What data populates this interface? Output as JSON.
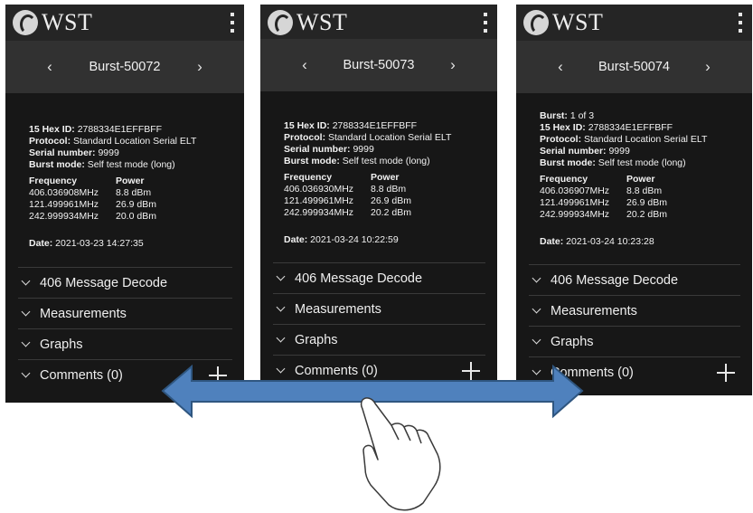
{
  "app": {
    "logo_text": "WST"
  },
  "screens": [
    {
      "title": "Burst-50072",
      "burst_prefix": "",
      "burst_value": "",
      "hex_label": "15 Hex ID:",
      "hex_value": " 2788334E1EFFBFF",
      "protocol_label": "Protocol:",
      "protocol_value": " Standard Location Serial ELT",
      "serial_label": "Serial number:",
      "serial_value": " 9999",
      "mode_label": "Burst mode:",
      "mode_value": " Self test mode (long)",
      "freq_header": "Frequency",
      "power_header": "Power",
      "rows": [
        {
          "f": "406.036908MHz",
          "p": "8.8 dBm"
        },
        {
          "f": "121.499961MHz",
          "p": "26.9 dBm"
        },
        {
          "f": "242.999934MHz",
          "p": "20.0 dBm"
        }
      ],
      "date_label": "Date:",
      "date_value": " 2021-03-23 14:27:35",
      "sections": [
        "406 Message Decode",
        "Measurements",
        "Graphs",
        "Comments (0)"
      ]
    },
    {
      "title": "Burst-50073",
      "burst_prefix": "",
      "burst_value": "",
      "hex_label": "15 Hex ID:",
      "hex_value": " 2788334E1EFFBFF",
      "protocol_label": "Protocol:",
      "protocol_value": " Standard Location Serial ELT",
      "serial_label": "Serial number:",
      "serial_value": " 9999",
      "mode_label": "Burst mode:",
      "mode_value": " Self test mode (long)",
      "freq_header": "Frequency",
      "power_header": "Power",
      "rows": [
        {
          "f": "406.036930MHz",
          "p": "8.8 dBm"
        },
        {
          "f": "121.499961MHz",
          "p": "26.9 dBm"
        },
        {
          "f": "242.999934MHz",
          "p": "20.2 dBm"
        }
      ],
      "date_label": "Date:",
      "date_value": " 2021-03-24 10:22:59",
      "sections": [
        "406 Message Decode",
        "Measurements",
        "Graphs",
        "Comments (0)"
      ]
    },
    {
      "title": "Burst-50074",
      "burst_prefix": "Burst:",
      "burst_value": " 1 of 3",
      "hex_label": "15 Hex ID:",
      "hex_value": " 2788334E1EFFBFF",
      "protocol_label": "Protocol:",
      "protocol_value": " Standard Location Serial ELT",
      "serial_label": "Serial number:",
      "serial_value": " 9999",
      "mode_label": "Burst mode:",
      "mode_value": " Self test mode (long)",
      "freq_header": "Frequency",
      "power_header": "Power",
      "rows": [
        {
          "f": "406.036907MHz",
          "p": "8.8 dBm"
        },
        {
          "f": "121.499961MHz",
          "p": "26.9 dBm"
        },
        {
          "f": "242.999934MHz",
          "p": "20.2 dBm"
        }
      ],
      "date_label": "Date:",
      "date_value": " 2021-03-24 10:23:28",
      "sections": [
        "406 Message Decode",
        "Measurements",
        "Graphs",
        "Comments (0)"
      ]
    }
  ],
  "icons": {
    "nav_prev": "chevron-left-icon",
    "nav_next": "chevron-right-icon",
    "menu": "more-vertical-icon",
    "expand": "chevron-down-icon",
    "add": "plus-icon",
    "swipe_arrow": "double-headed-arrow",
    "hand": "pointing-hand"
  },
  "colors": {
    "arrow_fill": "#4f81bd",
    "arrow_stroke": "#2f5680",
    "screen_bg": "#171717"
  }
}
